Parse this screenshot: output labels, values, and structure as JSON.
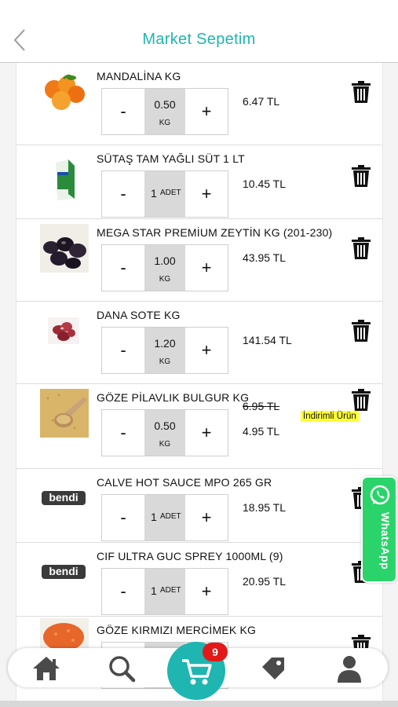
{
  "header": {
    "title": "Market Sepetim",
    "back_icon": "chevron-left-icon"
  },
  "labels": {
    "minus": "-",
    "plus": "+",
    "discount_badge": "İndirimli Ürün"
  },
  "colors": {
    "accent": "#1fb5b1",
    "discount": "#ffff33",
    "whatsapp": "#2bd46b",
    "badge": "#e31818"
  },
  "items": [
    {
      "name": "MANDALİNA KG",
      "qty": "0.50",
      "unit": "KG",
      "price": "6.47 TL",
      "image": "mandarin-image"
    },
    {
      "name": "SÜTAŞ TAM YAĞLI SÜT 1 LT",
      "qty": "1",
      "unit": "ADET",
      "price": "10.45 TL",
      "image": "milk-carton-image"
    },
    {
      "name": "MEGA STAR PREMİUM ZEYTİN KG (201-230)",
      "qty": "1.00",
      "unit": "KG",
      "price": "43.95 TL",
      "image": "olives-image"
    },
    {
      "name": "DANA SOTE KG",
      "qty": "1.20",
      "unit": "KG",
      "price": "141.54 TL",
      "image": "beef-image"
    },
    {
      "name": "GÖZE PİLAVLIK BULGUR KG",
      "qty": "0.50",
      "unit": "KG",
      "old_price": "6.95 TL",
      "price": "4.95 TL",
      "image": "bulgur-image"
    },
    {
      "name": "CALVE HOT SAUCE MPO 265 GR",
      "qty": "1",
      "unit": "ADET",
      "price": "18.95 TL",
      "image": "bendi-logo"
    },
    {
      "name": "CIF ULTRA GUC SPREY 1000ML (9)",
      "qty": "1",
      "unit": "ADET",
      "price": "20.95 TL",
      "image": "bendi-logo"
    },
    {
      "name": "GÖZE KIRMIZI MERCİMEK KG",
      "qty": "",
      "unit": "",
      "price": "",
      "image": "red-lentil-image"
    }
  ],
  "logo_text": "bendi",
  "whatsapp": {
    "label": "WhatsApp"
  },
  "bottom_nav": {
    "cart_count": "9",
    "icons": [
      "home-icon",
      "search-icon",
      "cart-icon",
      "tag-icon",
      "user-icon"
    ]
  }
}
